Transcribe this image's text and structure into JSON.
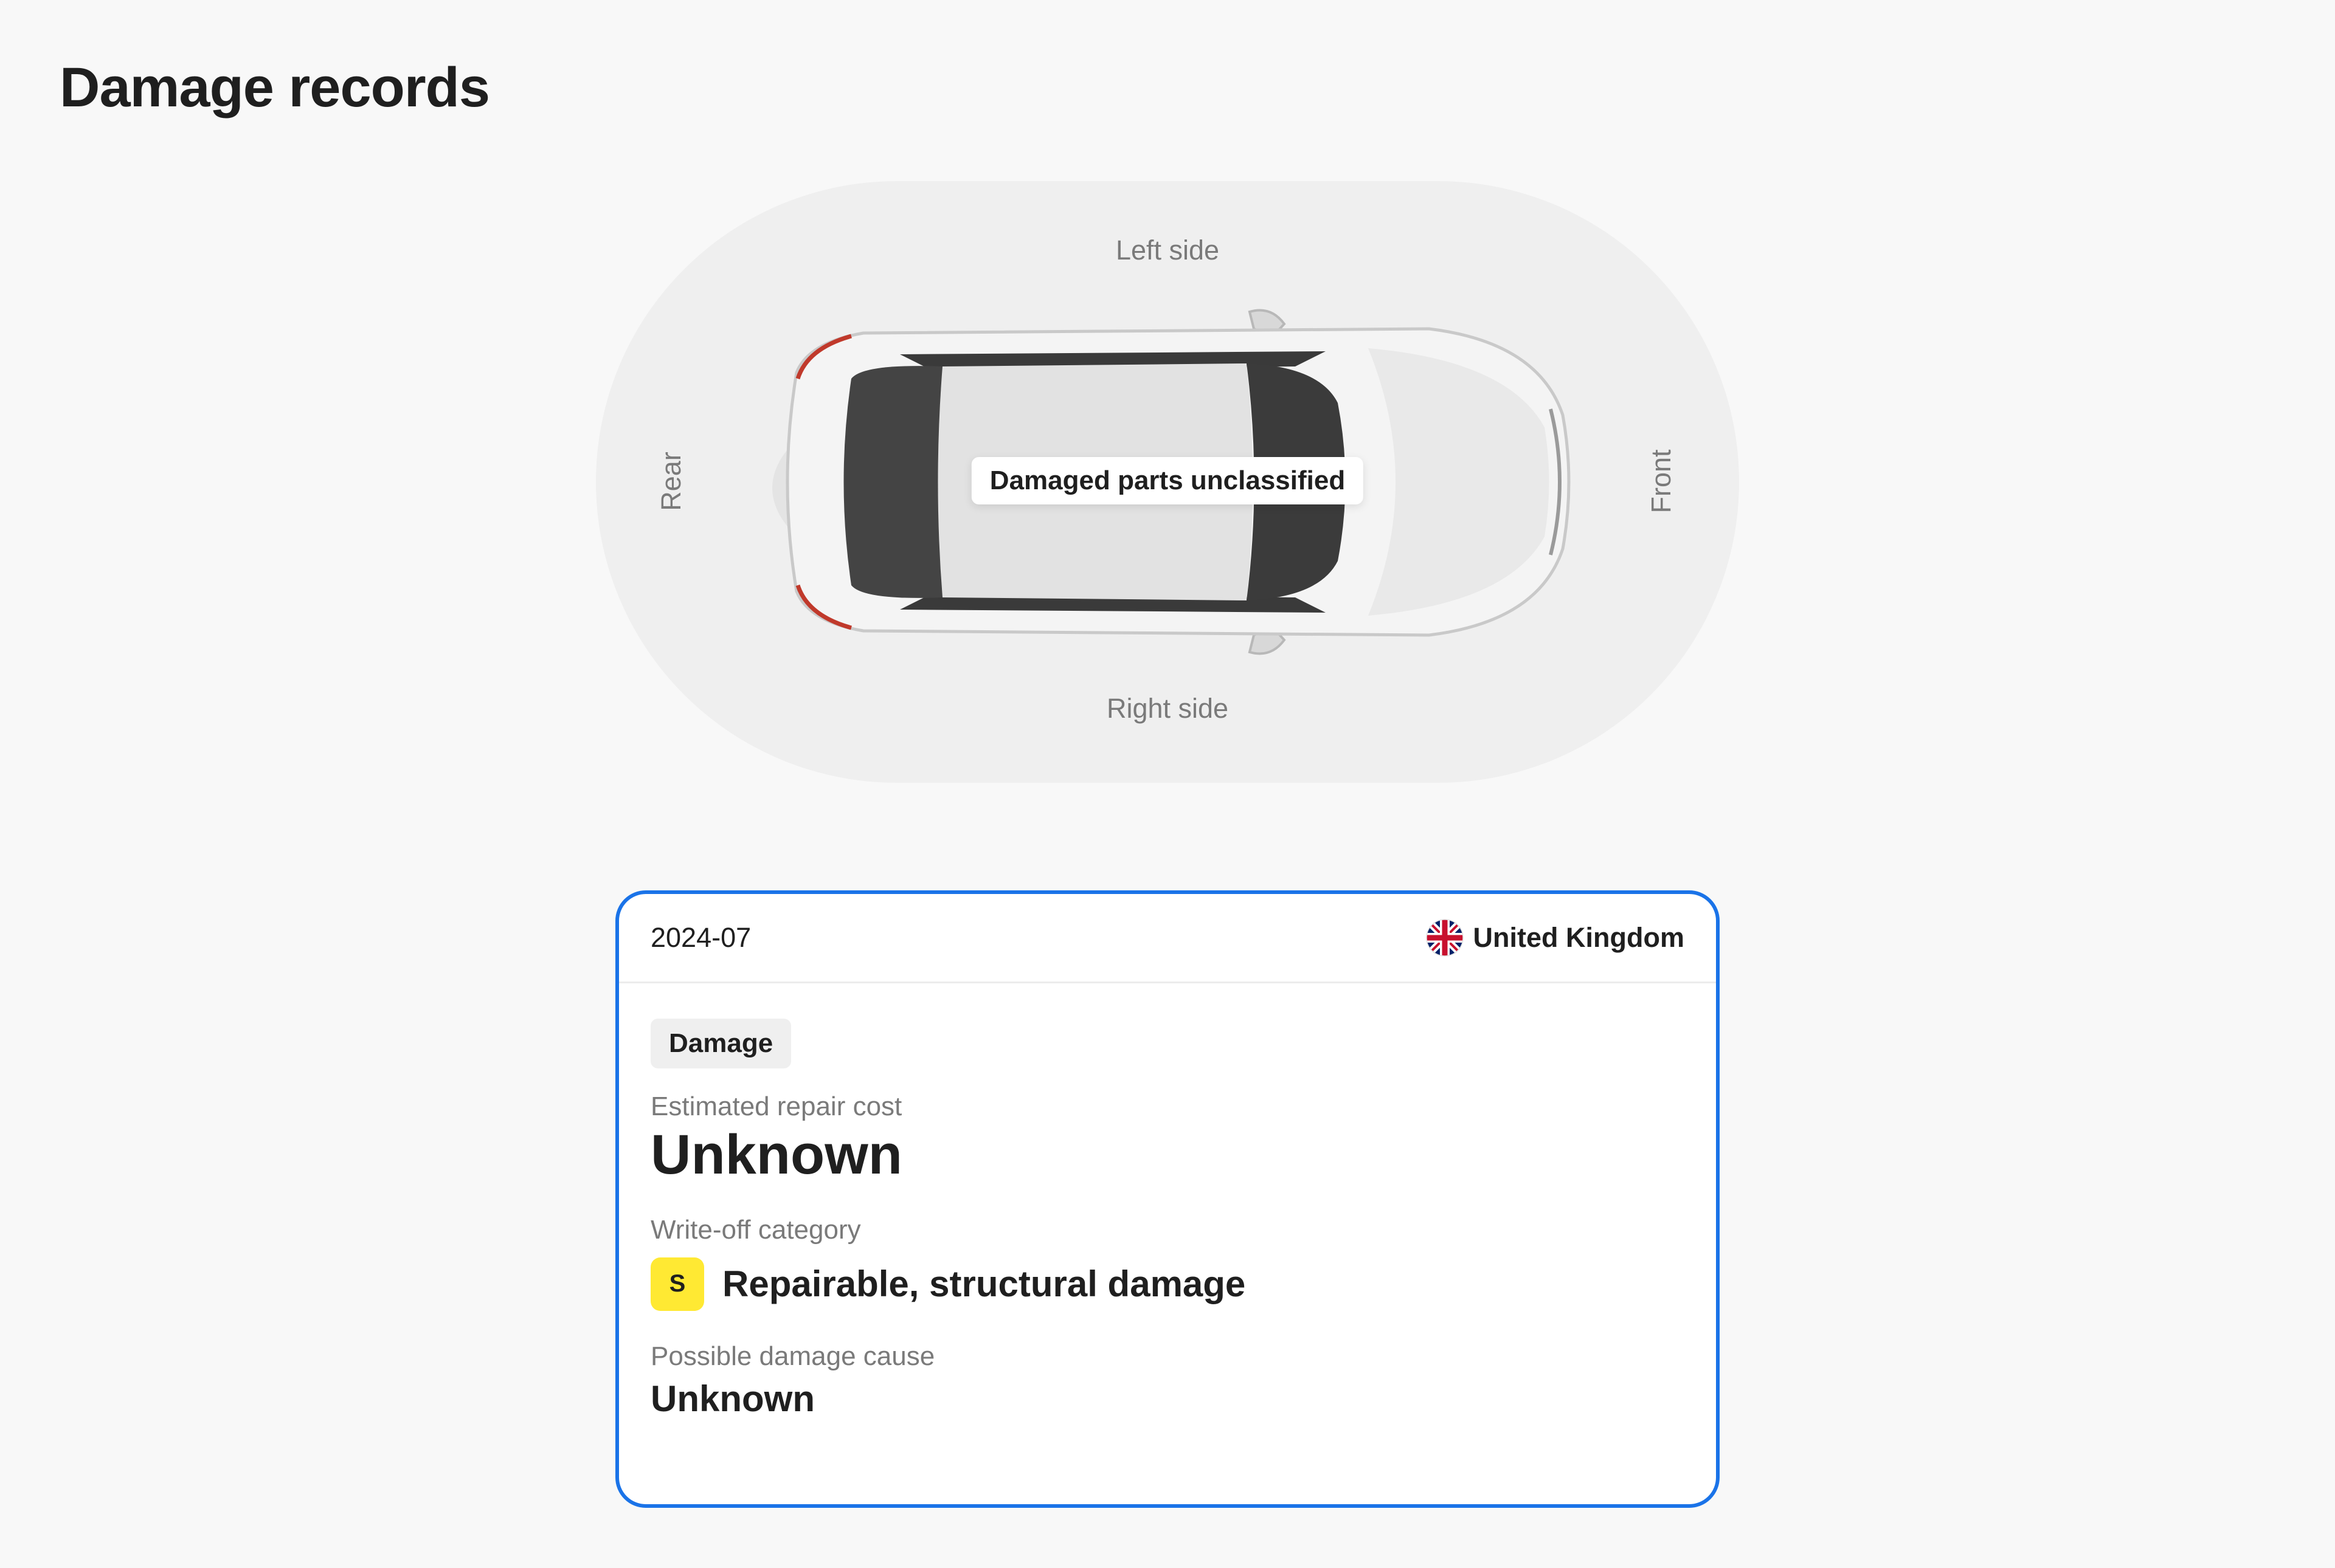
{
  "page": {
    "title": "Damage records"
  },
  "diagram": {
    "left_side_label": "Left side",
    "right_side_label": "Right side",
    "rear_label": "Rear",
    "front_label": "Front",
    "car_icon": "sedan-top-view-icon",
    "damage_tag": "Damaged parts unclassified"
  },
  "record": {
    "date": "2024-07",
    "country": "United Kingdom",
    "country_flag_icon": "uk-flag-icon",
    "type_badge": "Damage",
    "repair_cost_label": "Estimated repair cost",
    "repair_cost_value": "Unknown",
    "writeoff_label": "Write-off category",
    "writeoff_code": "S",
    "writeoff_text": "Repairable, structural damage",
    "cause_label": "Possible damage cause",
    "cause_value": "Unknown"
  },
  "colors": {
    "page_background": "#f8f8f8",
    "diagram_background": "#efefef",
    "card_border": "#1a73e8",
    "category_badge": "#ffe933",
    "muted_text": "#7a7a7a",
    "primary_text": "#1f1f1f"
  }
}
